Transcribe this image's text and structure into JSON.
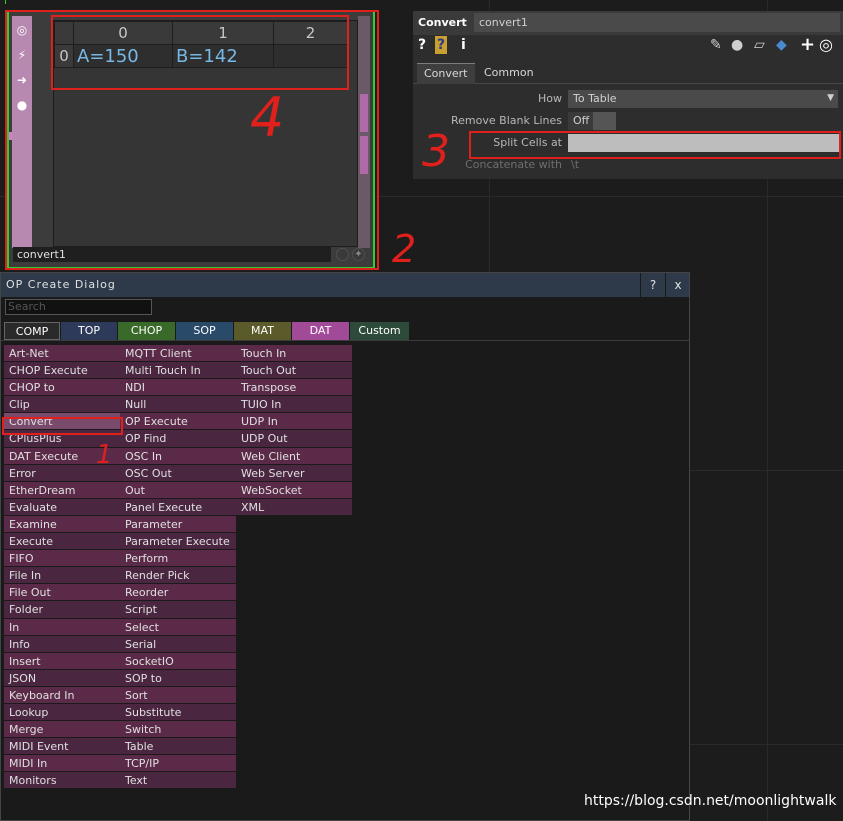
{
  "node": {
    "name": "convert1",
    "table": {
      "headers": [
        "0",
        "1",
        "2"
      ],
      "rows": [
        {
          "index": "0",
          "cells": [
            "A=150",
            "B=142",
            ""
          ]
        }
      ]
    }
  },
  "params": {
    "op_type": "Convert",
    "name": "convert1",
    "tabs": [
      "Convert",
      "Common"
    ],
    "how_label": "How",
    "how_value": "To Table",
    "remove_blank_label": "Remove Blank Lines",
    "remove_blank_value": "Off",
    "split_label": "Split Cells at",
    "split_value": "",
    "concat_label": "Concatenate with",
    "concat_value": "\\t"
  },
  "dialog": {
    "title": "OP Create Dialog",
    "help": "?",
    "close": "x",
    "search_placeholder": "Search",
    "families": [
      {
        "label": "COMP",
        "color": "#2a2a2a"
      },
      {
        "label": "TOP",
        "color": "#2d3a5a"
      },
      {
        "label": "CHOP",
        "color": "#3a6a2a"
      },
      {
        "label": "SOP",
        "color": "#2a4a6a"
      },
      {
        "label": "MAT",
        "color": "#5a5a2a"
      },
      {
        "label": "DAT",
        "color": "#a04a98"
      },
      {
        "label": "Custom",
        "color": "#2e4a3a"
      }
    ],
    "columns": [
      [
        "Art-Net",
        "CHOP Execute",
        "CHOP to",
        "Clip",
        "Convert",
        "CPlusPlus",
        "DAT Execute",
        "Error",
        "EtherDream",
        "Evaluate",
        "Examine",
        "Execute",
        "FIFO",
        "File In",
        "File Out",
        "Folder",
        "In",
        "Info",
        "Insert",
        "JSON",
        "Keyboard In",
        "Lookup",
        "Merge",
        "MIDI Event",
        "MIDI In",
        "Monitors"
      ],
      [
        "MQTT Client",
        "Multi Touch In",
        "NDI",
        "Null",
        "OP Execute",
        "OP Find",
        "OSC In",
        "OSC Out",
        "Out",
        "Panel Execute",
        "Parameter",
        "Parameter Execute",
        "Perform",
        "Render Pick",
        "Reorder",
        "Script",
        "Select",
        "Serial",
        "SocketIO",
        "SOP to",
        "Sort",
        "Substitute",
        "Switch",
        "Table",
        "TCP/IP",
        "Text"
      ],
      [
        "Touch In",
        "Touch Out",
        "Transpose",
        "TUIO In",
        "UDP In",
        "UDP Out",
        "Web Client",
        "Web Server",
        "WebSocket",
        "XML"
      ]
    ]
  },
  "annotations": [
    "1",
    "2",
    "3",
    "4"
  ],
  "watermark": "https://blog.csdn.net/moonlightwalk",
  "colors": {
    "annotation_red": "#e0201c",
    "dat_purple": "#a04a98",
    "cell_text": "#78b8e6",
    "node_select_green": "#2fd02f"
  }
}
